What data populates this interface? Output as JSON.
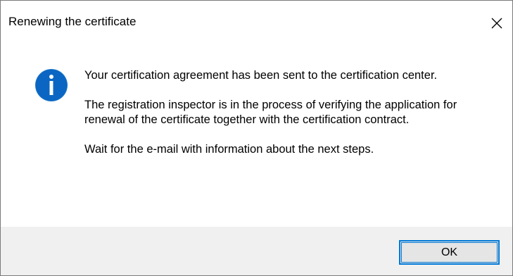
{
  "window": {
    "title": "Renewing the certificate"
  },
  "icons": {
    "info": "info-icon",
    "close": "close-icon"
  },
  "message": {
    "paragraph1": "Your certification agreement has been sent to the certification center.",
    "paragraph2": "The registration inspector is in the process of verifying the application for renewal of the certificate together with the certification contract.",
    "paragraph3": "Wait for the e-mail with information about the next steps."
  },
  "buttons": {
    "ok_label": "OK"
  },
  "colors": {
    "accent": "#0078d7",
    "footer_bg": "#f0f0f0",
    "button_bg": "#e5e5e5"
  }
}
